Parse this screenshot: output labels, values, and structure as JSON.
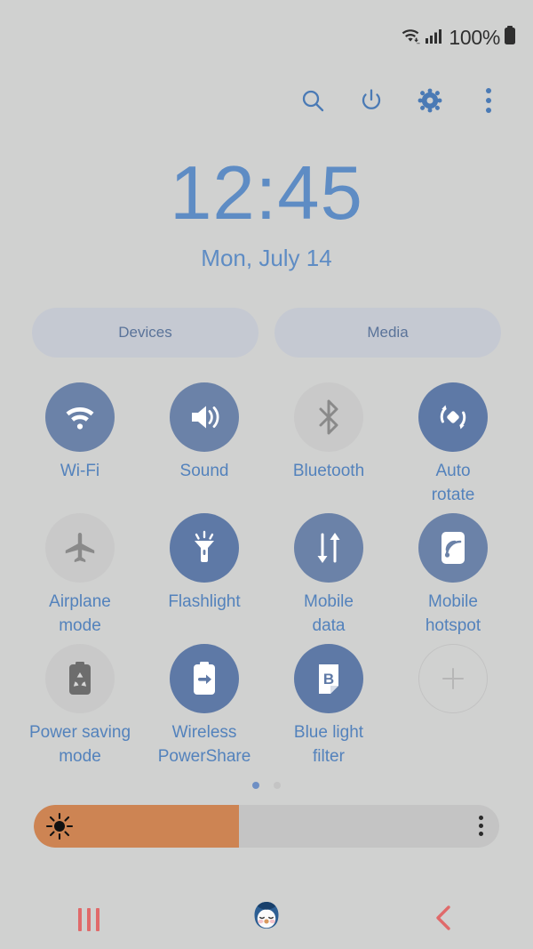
{
  "statusbar": {
    "wifi_icon": "wifi-transfer-icon",
    "signal_icon": "cellular-signal-icon",
    "battery_percent": "100%",
    "battery_icon": "battery-full-icon"
  },
  "toolbar": {
    "search_label": "search-icon",
    "power_label": "power-icon",
    "settings_label": "gear-icon",
    "menu_label": "overflow-menu-icon"
  },
  "clock": {
    "time": "12:45",
    "date": "Mon, July 14"
  },
  "pills": [
    {
      "label": "Devices",
      "name": "devices-button"
    },
    {
      "label": "Media",
      "name": "media-button"
    }
  ],
  "tiles": [
    {
      "label": "Wi-Fi",
      "icon": "wifi-icon",
      "state": "on"
    },
    {
      "label": "Sound",
      "icon": "sound-icon",
      "state": "on"
    },
    {
      "label": "Bluetooth",
      "icon": "bluetooth-icon",
      "state": "off"
    },
    {
      "label": "Auto\nrotate",
      "icon": "auto-rotate-icon",
      "state": "on2"
    },
    {
      "label": "Airplane\nmode",
      "icon": "airplane-icon",
      "state": "off"
    },
    {
      "label": "Flashlight",
      "icon": "flashlight-icon",
      "state": "on2"
    },
    {
      "label": "Mobile\ndata",
      "icon": "mobile-data-icon",
      "state": "on"
    },
    {
      "label": "Mobile\nhotspot",
      "icon": "hotspot-icon",
      "state": "on"
    },
    {
      "label": "Power saving\nmode",
      "icon": "power-saving-icon",
      "state": "off"
    },
    {
      "label": "Wireless\nPowerShare",
      "icon": "power-share-icon",
      "state": "on2"
    },
    {
      "label": "Blue light\nfilter",
      "icon": "blue-light-icon",
      "state": "on2"
    },
    {
      "label": "",
      "icon": "add-tile-icon",
      "state": "add"
    }
  ],
  "pagination": {
    "total": 2,
    "active": 1
  },
  "brightness": {
    "value_percent": 44,
    "icon": "brightness-sun-icon",
    "menu_icon": "overflow-menu-icon"
  },
  "navbar": {
    "recents_label": "recents-button",
    "home_label": "home-penguin-button",
    "back_label": "back-button"
  },
  "colors": {
    "background": "#d0d1d0",
    "accent_blue": "#5382bc",
    "tile_on": "#6b82a8",
    "tile_off": "#c9c9c9",
    "brightness_fill": "#cd8453",
    "nav_red": "#e06a6a"
  }
}
